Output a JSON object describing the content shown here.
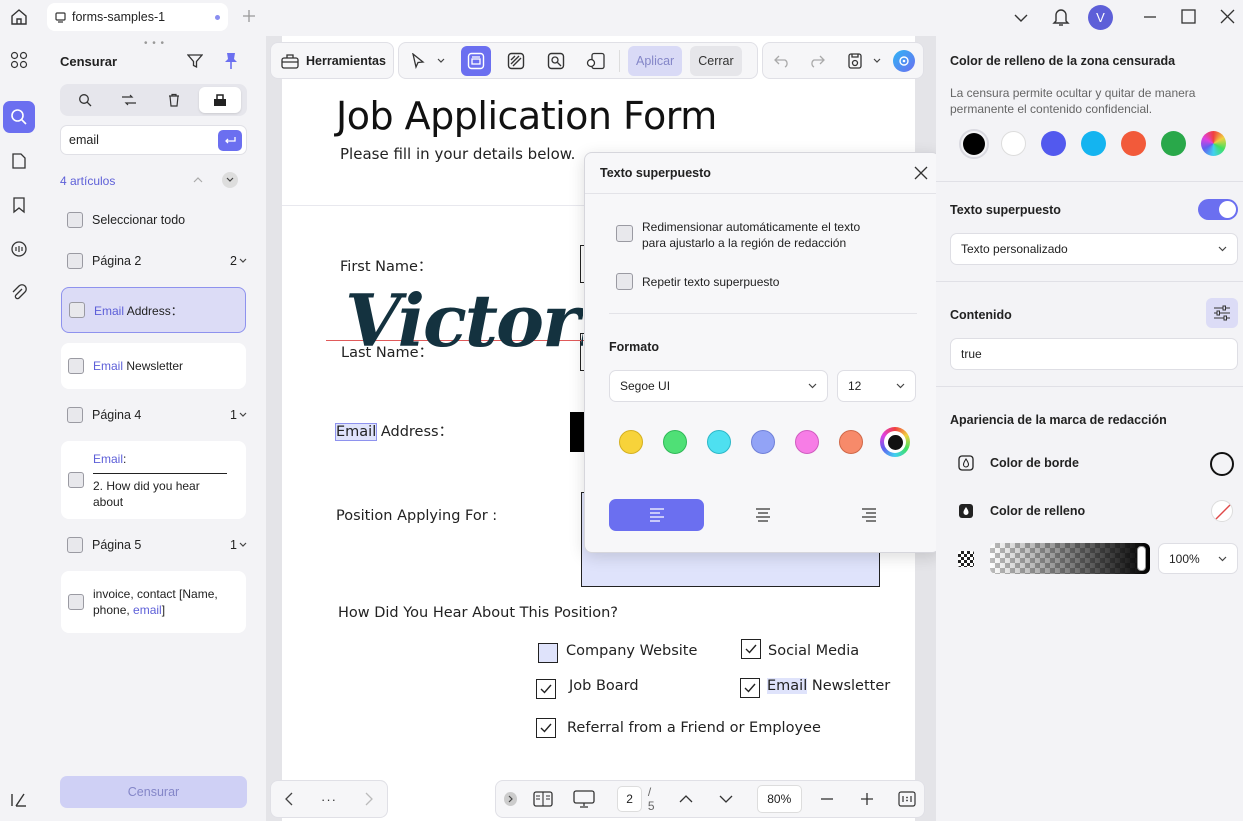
{
  "titlebar": {
    "tab_label": "forms-samples-1",
    "avatar_letter": "V"
  },
  "left_panel": {
    "title": "Censurar",
    "search_value": "email",
    "results_count": "4 artículos",
    "select_all": "Seleccionar todo",
    "groups": [
      {
        "page": "Página 2",
        "count": "2"
      },
      {
        "page": "Página 4",
        "count": "1"
      },
      {
        "page": "Página 5",
        "count": "1"
      }
    ],
    "results": [
      {
        "match": "Email",
        "rest": " Address："
      },
      {
        "match": "Email",
        "rest": " Newsletter"
      },
      {
        "match": "Email",
        "rest": ":",
        "line2": "2. How did you hear about"
      },
      {
        "pre": "invoice, contact [Name,",
        "pre2": "phone, ",
        "match": "email",
        "post": "]"
      }
    ],
    "censor_button": "Censurar"
  },
  "toolbar": {
    "tools_label": "Herramientas",
    "apply_label": "Aplicar",
    "close_label": "Cerrar"
  },
  "form": {
    "title": "Job Application Form",
    "subtitle": "Please fill in your details below.",
    "first_name": "First Name：",
    "last_name": "Last Name：",
    "signature": "Victoria",
    "email_word": "Email",
    "email_rest": " Address：",
    "position": "Position Applying For :",
    "how_heard": "How Did You Hear About This Position?",
    "options": {
      "company_website": "Company Website",
      "social_media": "Social Media",
      "job_board": "Job Board",
      "email_word": "Email",
      "newsletter_rest": " Newsletter",
      "referral": "Referral from a Friend or Employee"
    }
  },
  "popup": {
    "title": "Texto superpuesto",
    "option1_line1": "Redimensionar automáticamente el texto",
    "option1_line2": "para ajustarlo a la región de redacción",
    "option2": "Repetir texto superpuesto",
    "format_label": "Formato",
    "font": "Segoe UI",
    "size": "12",
    "colors": [
      "#f7d33a",
      "#4fe076",
      "#4ee0f0",
      "#92a3f6",
      "#f77de6",
      "#f78a6a",
      "#111111"
    ]
  },
  "right_panel": {
    "fill_title": "Color de relleno de la zona censurada",
    "fill_desc": "La censura permite ocultar y quitar de manera permanente el contenido confidencial.",
    "fill_colors": [
      "#000000",
      "#ffffff",
      "#5259ee",
      "#14b4f0",
      "#f25a3a",
      "#29a84a"
    ],
    "overlay_title": "Texto superpuesto",
    "overlay_select": "Texto personalizado",
    "content_label": "Contenido",
    "content_value": "true",
    "appearance_title": "Apariencia de la marca de redacción",
    "border_color": "Color de borde",
    "fill_color": "Color de relleno",
    "opacity": "100%"
  },
  "bottombar": {
    "page_current": "2",
    "page_total": "/ 5",
    "zoom": "80%"
  }
}
